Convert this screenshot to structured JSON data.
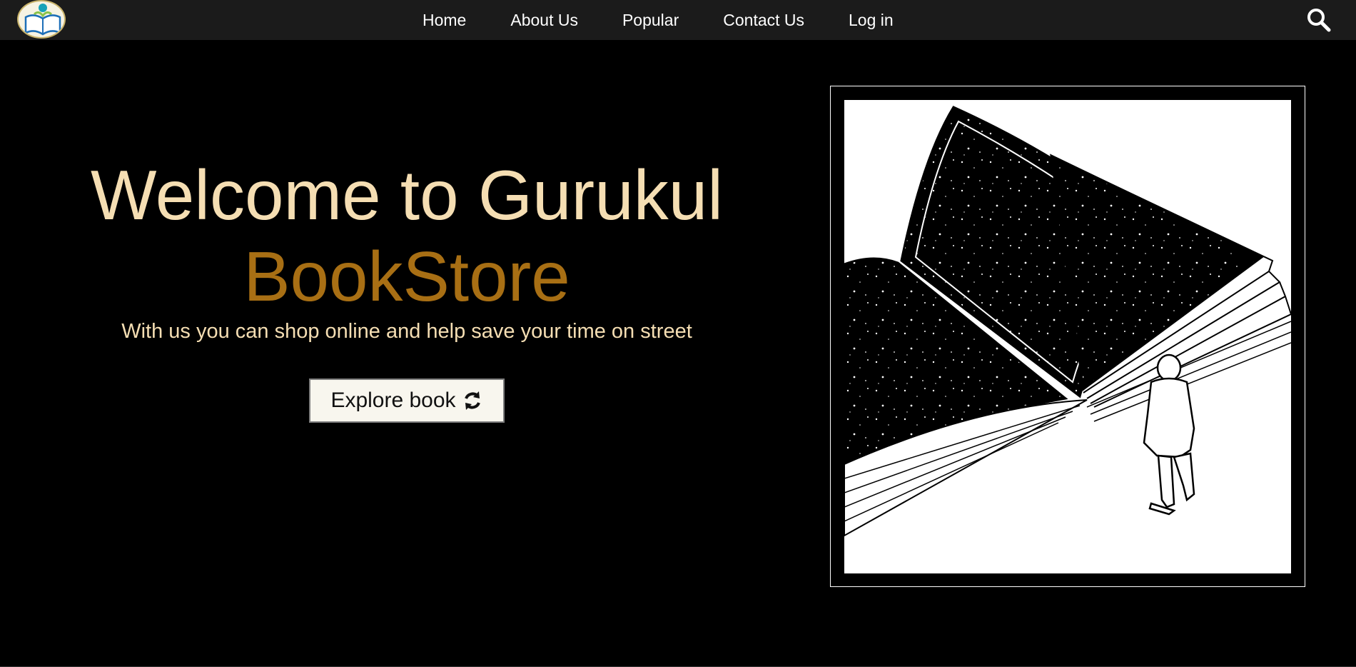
{
  "nav": {
    "logo_icon": "book-reader-logo-icon",
    "links": [
      {
        "label": "Home"
      },
      {
        "label": "About Us"
      },
      {
        "label": "Popular"
      },
      {
        "label": "Contact Us"
      },
      {
        "label": "Log in"
      }
    ],
    "search_icon": "search-icon"
  },
  "hero": {
    "title_line1": "Welcome to Gurukul",
    "title_line2": "BookStore",
    "subtitle": "With us you can shop online and help save your time on street",
    "cta_label": "Explore book",
    "cta_icon": "refresh-icon",
    "illustration": "open-book-starry-night-with-man-illustration"
  },
  "colors": {
    "navbar_bg": "#1b1b1b",
    "page_bg": "#000000",
    "title_primary": "#f5deb3",
    "title_accent": "#a86f14",
    "button_bg": "#f8f6ee"
  }
}
